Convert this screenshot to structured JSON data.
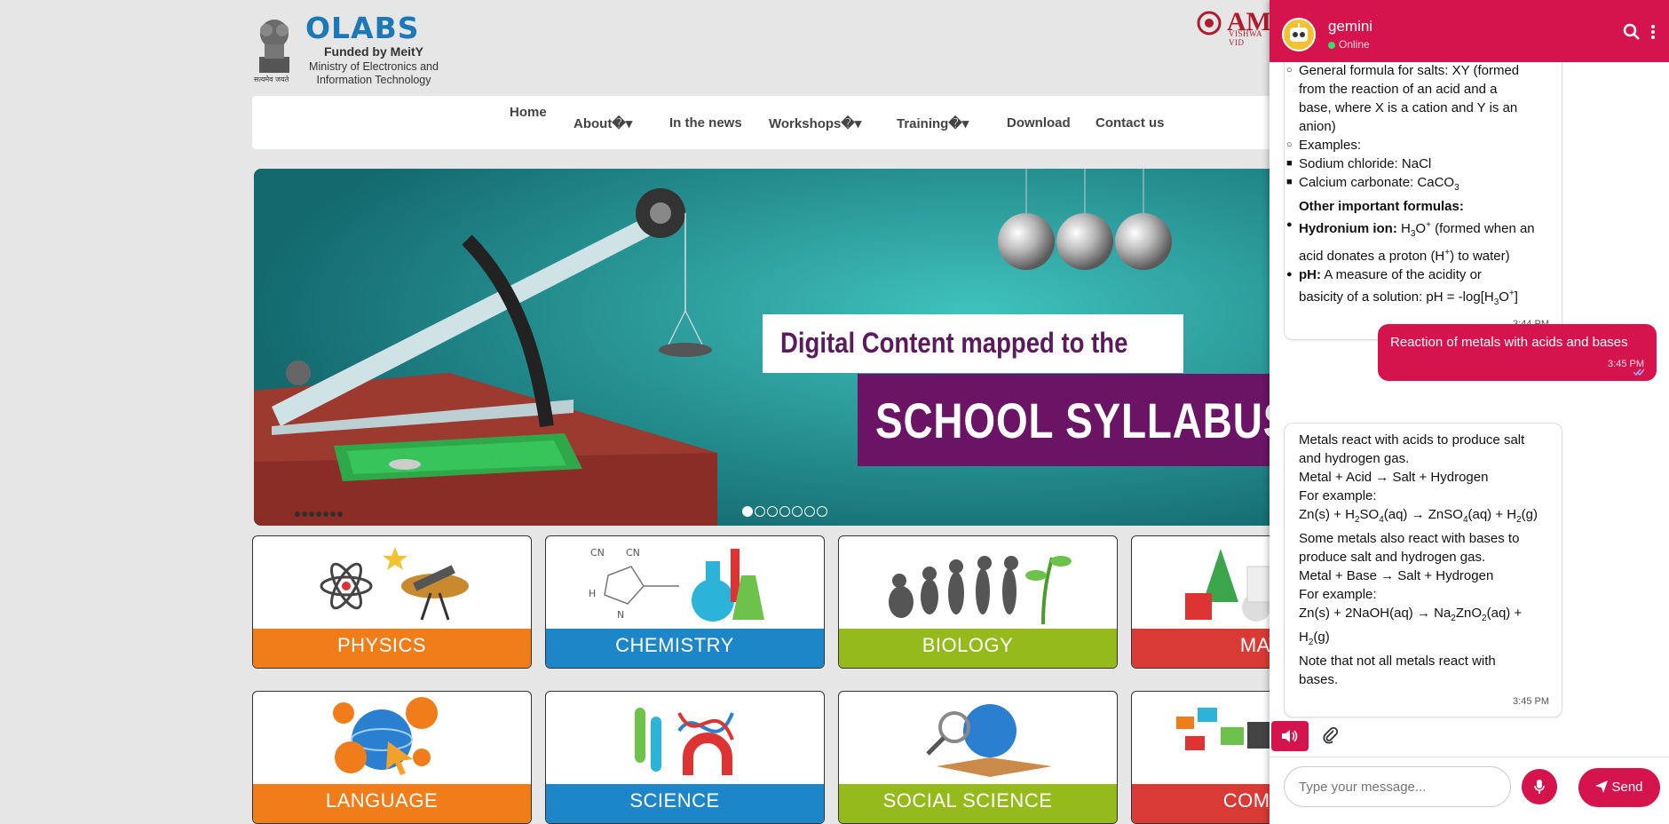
{
  "header": {
    "emblem_motto": "सत्यमेव जयते",
    "logo": "OLABS",
    "funded_by": "Funded by MeitY",
    "ministry_line1": "Ministry of Electronics and",
    "ministry_line2": "Information Technology",
    "partner_logo": "AMI",
    "partner_sub": "VISHWA VID"
  },
  "nav": {
    "home": "Home",
    "about": "About�▾",
    "news": "In the news",
    "workshops": "Workshops�▾",
    "training": "Training�▾",
    "download": "Download",
    "contact": "Contact us"
  },
  "hero": {
    "line1": "Digital Content mapped to the",
    "line2": "SCHOOL SYLLABUS",
    "slide_count": 7,
    "active_slide": 1
  },
  "subjects": {
    "physics": "PHYSICS",
    "chemistry": "CHEMISTRY",
    "biology": "BIOLOGY",
    "maths": "MAT",
    "language": "LANGUAGE",
    "science": "SCIENCE",
    "social": "SOCIAL SCIENCE",
    "computer": "COMPU"
  },
  "chat": {
    "name": "gemini",
    "status": "Online",
    "msg1": {
      "l1": "General formula for salts: XY (formed",
      "l2": "from the reaction of an acid and a",
      "l3": "base, where X is a cation and Y is an",
      "l4": "anion)",
      "l5": "Examples:",
      "l6": "Sodium chloride: NaCl",
      "l7": "Calcium carbonate: CaCO",
      "l7sub": "3",
      "l8": "Other important formulas:",
      "l9_bold": "Hydronium ion:",
      "l9": " H",
      "l9sub": "3",
      "l9b": "O",
      "l9sup": "+",
      "l9c": " (formed when an",
      "l10": "acid donates a proton (H",
      "l10sup": "+",
      "l10b": ") to water)",
      "l11_bold": "pH:",
      "l11": " A measure of the acidity or",
      "l12": "basicity of a solution: pH = -log[H",
      "l12sub": "3",
      "l12b": "O",
      "l12sup": "+",
      "l12c": "]",
      "time": "3:44 PM"
    },
    "msg2": {
      "text": "Reaction of metals with acids and bases",
      "time": "3:45 PM"
    },
    "msg3": {
      "l1": "Metals react with acids to produce salt",
      "l2": "and hydrogen gas.",
      "l3": "Metal + Acid → Salt + Hydrogen",
      "l4": "For example:",
      "l5a": "Zn(s) + H",
      "l5s1": "2",
      "l5b": "SO",
      "l5s2": "4",
      "l5c": "(aq) → ZnSO",
      "l5s3": "4",
      "l5d": "(aq) + H",
      "l5s4": "2",
      "l5e": "(g)",
      "l6": "Some metals also react with bases to",
      "l7": "produce salt and hydrogen gas.",
      "l8": "Metal + Base → Salt + Hydrogen",
      "l9": "For example:",
      "l10a": "Zn(s) + 2NaOH(aq) → Na",
      "l10s1": "2",
      "l10b": "ZnO",
      "l10s2": "2",
      "l10c": "(aq) +",
      "l11a": "H",
      "l11s": "2",
      "l11b": "(g)",
      "l12": "Note that not all metals react with",
      "l13": "bases.",
      "time": "3:45 PM"
    },
    "input_placeholder": "Type your message...",
    "send_label": "Send"
  },
  "colors": {
    "brand": "#d5134d",
    "physics": "#f07d1a",
    "chemistry": "#1c86c8",
    "biology": "#94bb1b",
    "maths": "#d93a35"
  }
}
